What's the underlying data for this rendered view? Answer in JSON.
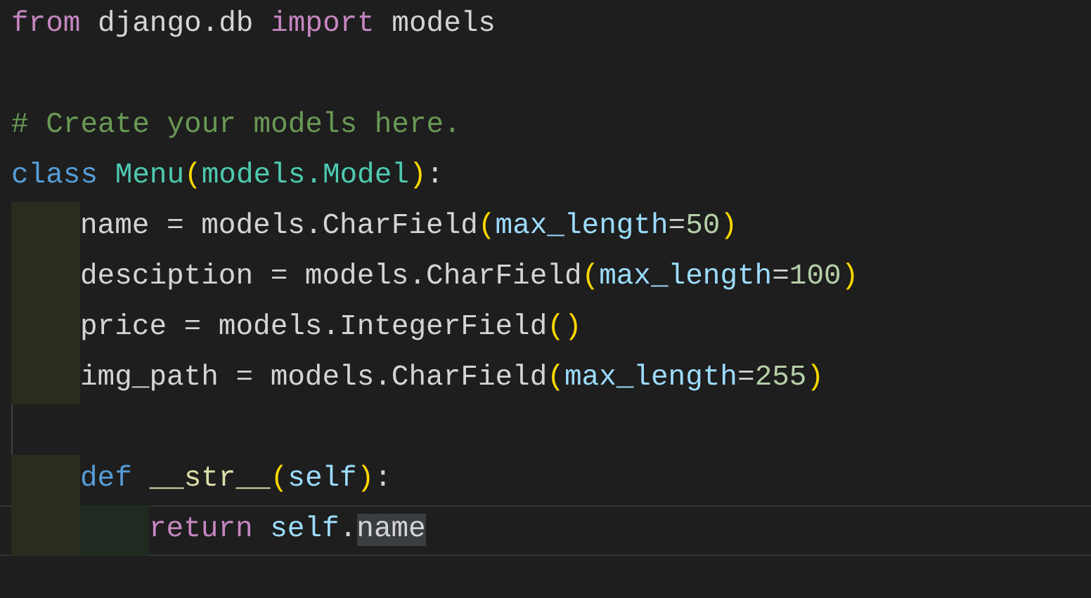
{
  "editor": {
    "lines": [
      {
        "kind": "code",
        "current": false,
        "tokens": [
          {
            "text": "from",
            "kind": "keyword"
          },
          {
            "text": " django.db ",
            "kind": "plain"
          },
          {
            "text": "import",
            "kind": "keyword"
          },
          {
            "text": " models",
            "kind": "plain"
          }
        ]
      },
      {
        "kind": "blank",
        "current": false
      },
      {
        "kind": "code",
        "current": false,
        "tokens": [
          {
            "text": "# Create your models here.",
            "kind": "comment"
          }
        ]
      },
      {
        "kind": "code",
        "current": false,
        "tokens": [
          {
            "text": "class ",
            "kind": "storage"
          },
          {
            "text": "Menu",
            "kind": "type"
          },
          {
            "text": "(",
            "kind": "paren"
          },
          {
            "text": "models.Model",
            "kind": "type"
          },
          {
            "text": ")",
            "kind": "paren"
          },
          {
            "text": ":",
            "kind": "plain"
          }
        ],
        "children": [
          {
            "kind": "code",
            "current": false,
            "tokens": [
              {
                "text": "name = models.CharField",
                "kind": "plain"
              },
              {
                "text": "(",
                "kind": "paren"
              },
              {
                "text": "max_length",
                "kind": "param"
              },
              {
                "text": "=",
                "kind": "plain"
              },
              {
                "text": "50",
                "kind": "number"
              },
              {
                "text": ")",
                "kind": "paren"
              }
            ]
          },
          {
            "kind": "code",
            "current": false,
            "tokens": [
              {
                "text": "desciption = models.CharField",
                "kind": "plain"
              },
              {
                "text": "(",
                "kind": "paren"
              },
              {
                "text": "max_length",
                "kind": "param"
              },
              {
                "text": "=",
                "kind": "plain"
              },
              {
                "text": "100",
                "kind": "number"
              },
              {
                "text": ")",
                "kind": "paren"
              }
            ]
          },
          {
            "kind": "code",
            "current": false,
            "tokens": [
              {
                "text": "price = models.IntegerField",
                "kind": "plain"
              },
              {
                "text": "()",
                "kind": "paren"
              }
            ]
          },
          {
            "kind": "code",
            "current": false,
            "tokens": [
              {
                "text": "img_path = models.CharField",
                "kind": "plain"
              },
              {
                "text": "(",
                "kind": "paren"
              },
              {
                "text": "max_length",
                "kind": "param"
              },
              {
                "text": "=",
                "kind": "plain"
              },
              {
                "text": "255",
                "kind": "number"
              },
              {
                "text": ")",
                "kind": "paren"
              }
            ]
          },
          {
            "kind": "blank",
            "current": false
          },
          {
            "kind": "code",
            "current": false,
            "tokens": [
              {
                "text": "def ",
                "kind": "storage"
              },
              {
                "text": "__str__",
                "kind": "function"
              },
              {
                "text": "(",
                "kind": "paren"
              },
              {
                "text": "self",
                "kind": "param"
              },
              {
                "text": ")",
                "kind": "paren"
              },
              {
                "text": ":",
                "kind": "plain"
              }
            ],
            "children": [
              {
                "kind": "code",
                "current": true,
                "tokens": [
                  {
                    "text": "return ",
                    "kind": "keyword"
                  },
                  {
                    "text": "self",
                    "kind": "param"
                  },
                  {
                    "text": ".",
                    "kind": "plain"
                  },
                  {
                    "text": "name",
                    "kind": "plain",
                    "highlighted": true
                  }
                ]
              }
            ]
          }
        ]
      }
    ]
  }
}
